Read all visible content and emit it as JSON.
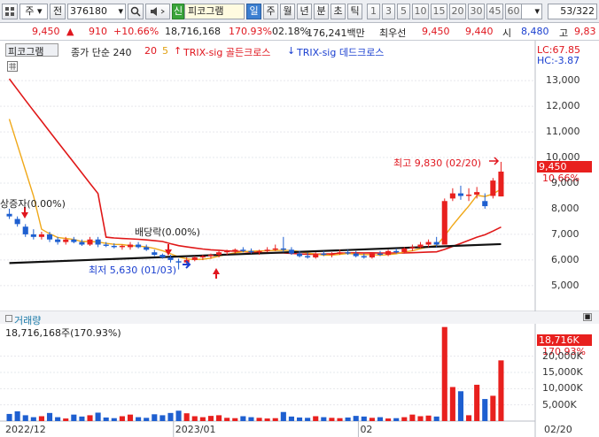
{
  "toolbar": {
    "menu_icon": "grid-icon",
    "market": "주",
    "prev": "전",
    "code": "376180",
    "name_badge": "신",
    "program": "피코그램",
    "periods": [
      "일",
      "주",
      "월",
      "년",
      "분",
      "초",
      "틱"
    ],
    "intervals": [
      "1",
      "3",
      "5",
      "10",
      "15",
      "20",
      "30",
      "45",
      "60"
    ],
    "count_select": "5",
    "page_counter": "53/322"
  },
  "info": {
    "price": "9,450",
    "change": "910",
    "change_pct": "+10.66%",
    "volume": "18,716,168",
    "vol_ratio": "170.93%",
    "turnover": "02.18%",
    "amount": "176,241백만",
    "best_label": "최우선",
    "ask": "9,450",
    "bid": "9,440",
    "open_label": "시",
    "open": "8,480",
    "high_label": "고",
    "high": "9,83"
  },
  "legend": {
    "title": "피코그램",
    "ma": "종가 단순 240",
    "p1": "20",
    "p2": "5",
    "golden": "TRIX-sig 골든크로스",
    "dead": "TRIX-sig 데드크로스",
    "lc": "LC:67.85",
    "hc": "HC:-3.87"
  },
  "annotations": {
    "rights": "상증자(0.00%)",
    "dividend": "배당락(0.00%)",
    "low": "최저 5,630 (01/03)",
    "high": "최고 9,830 (02/20)",
    "cur_price": "9,450",
    "cur_pct": "10.66%"
  },
  "volume_panel": {
    "title": "거래량",
    "value": "18,716,168주(170.93%)",
    "cur_vol": "18,716K",
    "cur_pct": "170.93%"
  },
  "chart_data": [
    {
      "type": "candlestick",
      "title": "",
      "ylim": [
        4200,
        13800
      ],
      "yticks": [
        5000,
        6000,
        7000,
        8000,
        9000,
        10000,
        11000,
        12000,
        13000
      ],
      "ytick_labels": [
        "5,000",
        "6,000",
        "7,000",
        "8,000",
        "9,000",
        "10,000",
        "11,000",
        "12,000",
        "13,000"
      ],
      "x_labels": [
        "2022/12",
        "2023/01",
        "02",
        "02/20"
      ],
      "candles": [
        [
          7800,
          8000,
          7600,
          7700
        ],
        [
          7600,
          7700,
          7300,
          7400
        ],
        [
          7300,
          7400,
          6900,
          7000
        ],
        [
          7000,
          7200,
          6800,
          6900
        ],
        [
          6900,
          7100,
          6800,
          7000
        ],
        [
          7000,
          7100,
          6700,
          6800
        ],
        [
          6800,
          6900,
          6600,
          6700
        ],
        [
          6700,
          6900,
          6600,
          6800
        ],
        [
          6800,
          6900,
          6650,
          6700
        ],
        [
          6700,
          6800,
          6550,
          6600
        ],
        [
          6600,
          6900,
          6550,
          6800
        ],
        [
          6800,
          6900,
          6500,
          6600
        ],
        [
          6600,
          6700,
          6500,
          6550
        ],
        [
          6550,
          6650,
          6450,
          6500
        ],
        [
          6500,
          6600,
          6400,
          6550
        ],
        [
          6500,
          6700,
          6400,
          6600
        ],
        [
          6600,
          6700,
          6450,
          6500
        ],
        [
          6500,
          6600,
          6350,
          6400
        ],
        [
          6300,
          6400,
          6150,
          6200
        ],
        [
          6200,
          6250,
          6050,
          6100
        ],
        [
          6100,
          6200,
          5900,
          6000
        ],
        [
          5950,
          6050,
          5630,
          5900
        ],
        [
          5900,
          6100,
          5800,
          6000
        ],
        [
          6000,
          6150,
          5950,
          6100
        ],
        [
          6100,
          6200,
          6000,
          6150
        ],
        [
          6150,
          6250,
          6050,
          6200
        ],
        [
          6200,
          6350,
          6100,
          6300
        ],
        [
          6300,
          6400,
          6200,
          6350
        ],
        [
          6350,
          6450,
          6250,
          6400
        ],
        [
          6400,
          6500,
          6300,
          6350
        ],
        [
          6350,
          6450,
          6250,
          6300
        ],
        [
          6300,
          6400,
          6200,
          6350
        ],
        [
          6350,
          6500,
          6300,
          6400
        ],
        [
          6400,
          6600,
          6350,
          6450
        ],
        [
          6450,
          6900,
          6300,
          6400
        ],
        [
          6400,
          6500,
          6200,
          6250
        ],
        [
          6250,
          6350,
          6100,
          6150
        ],
        [
          6150,
          6300,
          6050,
          6100
        ],
        [
          6100,
          6300,
          6050,
          6250
        ],
        [
          6250,
          6350,
          6150,
          6200
        ],
        [
          6200,
          6300,
          6100,
          6250
        ],
        [
          6250,
          6400,
          6200,
          6300
        ],
        [
          6300,
          6400,
          6200,
          6250
        ],
        [
          6250,
          6350,
          6100,
          6150
        ],
        [
          6150,
          6250,
          6050,
          6100
        ],
        [
          6100,
          6300,
          6050,
          6250
        ],
        [
          6250,
          6350,
          6150,
          6200
        ],
        [
          6200,
          6400,
          6150,
          6350
        ],
        [
          6350,
          6450,
          6250,
          6300
        ],
        [
          6300,
          6500,
          6250,
          6450
        ],
        [
          6450,
          6600,
          6350,
          6500
        ],
        [
          6500,
          6700,
          6450,
          6600
        ],
        [
          6600,
          6800,
          6500,
          6700
        ],
        [
          6700,
          6900,
          6500,
          6600
        ],
        [
          6600,
          8400,
          6600,
          8300
        ],
        [
          8400,
          8800,
          8300,
          8600
        ],
        [
          8600,
          8900,
          8350,
          8500
        ],
        [
          8500,
          8800,
          8300,
          8550
        ],
        [
          8550,
          8850,
          8400,
          8650
        ],
        [
          8300,
          8600,
          8000,
          8100
        ],
        [
          8500,
          9200,
          8400,
          9100
        ],
        [
          8480,
          9830,
          8480,
          9450
        ]
      ]
    },
    {
      "type": "bar",
      "title": "",
      "ylim": [
        0,
        30000
      ],
      "yticks": [
        5000,
        10000,
        15000,
        20000
      ],
      "ytick_labels": [
        "5,000K",
        "10,000K",
        "15,000K",
        "20,000K"
      ],
      "values": [
        2200,
        3000,
        1800,
        1200,
        1500,
        2500,
        1200,
        800,
        2000,
        1400,
        1800,
        2600,
        1100,
        900,
        1500,
        2000,
        1200,
        1000,
        2100,
        1800,
        2500,
        3200,
        2400,
        1500,
        1200,
        1600,
        1800,
        1000,
        900,
        1500,
        1200,
        1000,
        800,
        900,
        2800,
        1400,
        1100,
        1000,
        1500,
        1200,
        1000,
        900,
        1100,
        1600,
        1400,
        1000,
        1200,
        800,
        900,
        1200,
        2000,
        1500,
        1700,
        1400,
        29000,
        10500,
        9200,
        1800,
        11200,
        6800,
        7800,
        18716
      ]
    }
  ],
  "colors": {
    "up": "#e8201e",
    "down": "#1e5fd0",
    "ma5": "#f0a818",
    "ma20": "#e01818",
    "ma240": "#111111",
    "toolbar_bg": "#eceef2"
  }
}
